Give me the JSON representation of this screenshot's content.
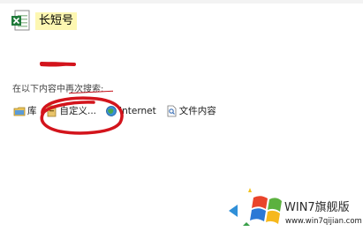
{
  "file": {
    "name": "长短号",
    "icon": "excel-file-icon"
  },
  "search": {
    "hint": "在以下内容中再次搜索:",
    "options": [
      {
        "label": "库",
        "icon": "library-icon"
      },
      {
        "label": "自定义...",
        "icon": "custom-folder-icon"
      },
      {
        "label": "Internet",
        "icon": "internet-icon"
      },
      {
        "label": "文件内容",
        "icon": "file-content-icon"
      }
    ]
  },
  "watermark": {
    "title": "WIN7旗舰版",
    "url": "www.win7qijian.com"
  },
  "colors": {
    "highlight": "#fdf7b2",
    "annotation_red": "#d3141c",
    "excel_green": "#1f7a3a"
  }
}
